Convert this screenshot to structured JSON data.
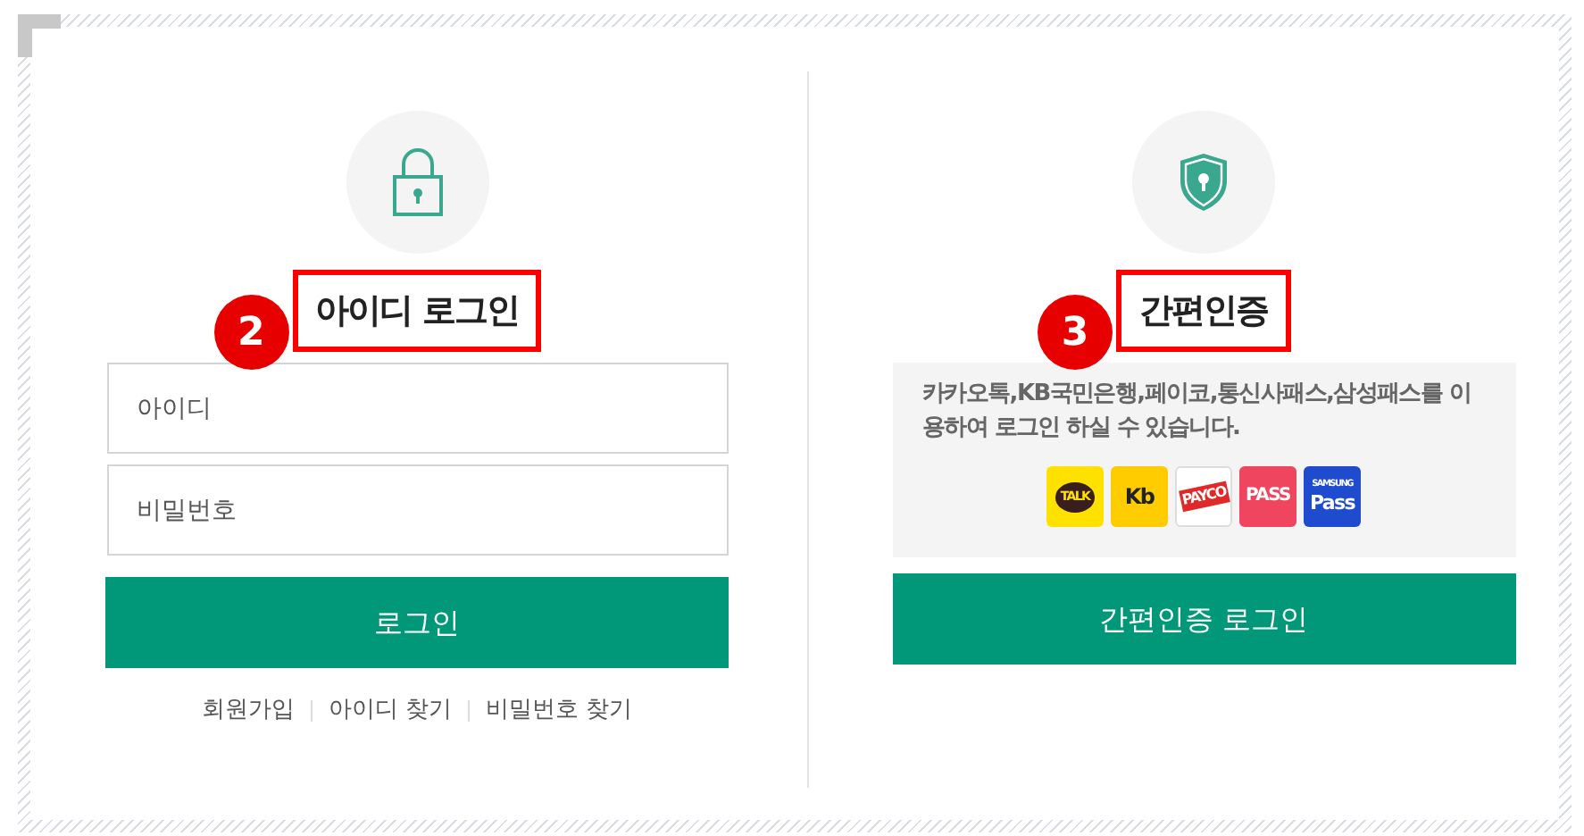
{
  "id_login": {
    "badge": "2",
    "title": "아이디 로그인",
    "fields": [
      {
        "placeholder": "아이디"
      },
      {
        "placeholder": "비밀번호"
      }
    ],
    "button": "로그인",
    "links": [
      "회원가입",
      "아이디 찾기",
      "비밀번호 찾기"
    ]
  },
  "easy_login": {
    "badge": "3",
    "title": "간편인증",
    "description": "카카오톡,KB국민은행,페이코,통신사패스,삼성패스를 이용하여 로그인 하실 수 있습니다.",
    "providers": [
      {
        "kind": "kakao",
        "label": "TALK"
      },
      {
        "kind": "kb",
        "label": "Kb"
      },
      {
        "kind": "payco",
        "label": "PAYCO"
      },
      {
        "kind": "pass",
        "label": "PASS"
      },
      {
        "kind": "samsung",
        "label": "SAMSUNG",
        "sublabel": "Pass"
      }
    ],
    "button": "간편인증 로그인"
  }
}
